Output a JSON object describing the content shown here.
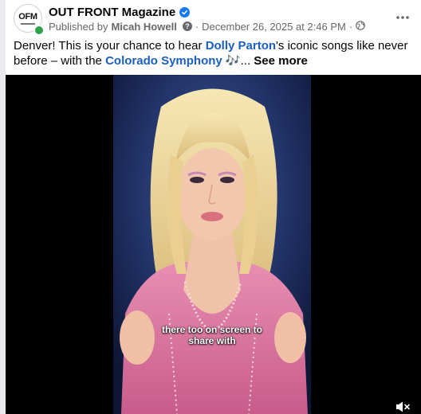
{
  "post": {
    "page_name": "OUT FRONT Magazine",
    "avatar_text": "OFM",
    "published_prefix": "Published by",
    "author": "Micah Howell",
    "date": "December 26, 2025 at 2:46 PM",
    "dot": "·",
    "help_glyph": "?",
    "more_icon": "more-horizontal-icon",
    "privacy_icon": "globe-icon"
  },
  "caption": {
    "part1": "Denver! This is your chance to hear ",
    "link1": "Dolly Parton",
    "part2": "'s iconic songs like never before – with the ",
    "link2": "Colorado Symphony",
    "emoji": " 🎶",
    "ellipsis": "... ",
    "see_more": "See more"
  },
  "video": {
    "subtitle_line1": "there too on screen to",
    "subtitle_line2": "share with",
    "mute_icon": "muted-speaker-icon"
  },
  "colors": {
    "link": "#1b5fc1",
    "verified": "#1877f2",
    "online": "#31a24c",
    "meta": "#65676b"
  }
}
